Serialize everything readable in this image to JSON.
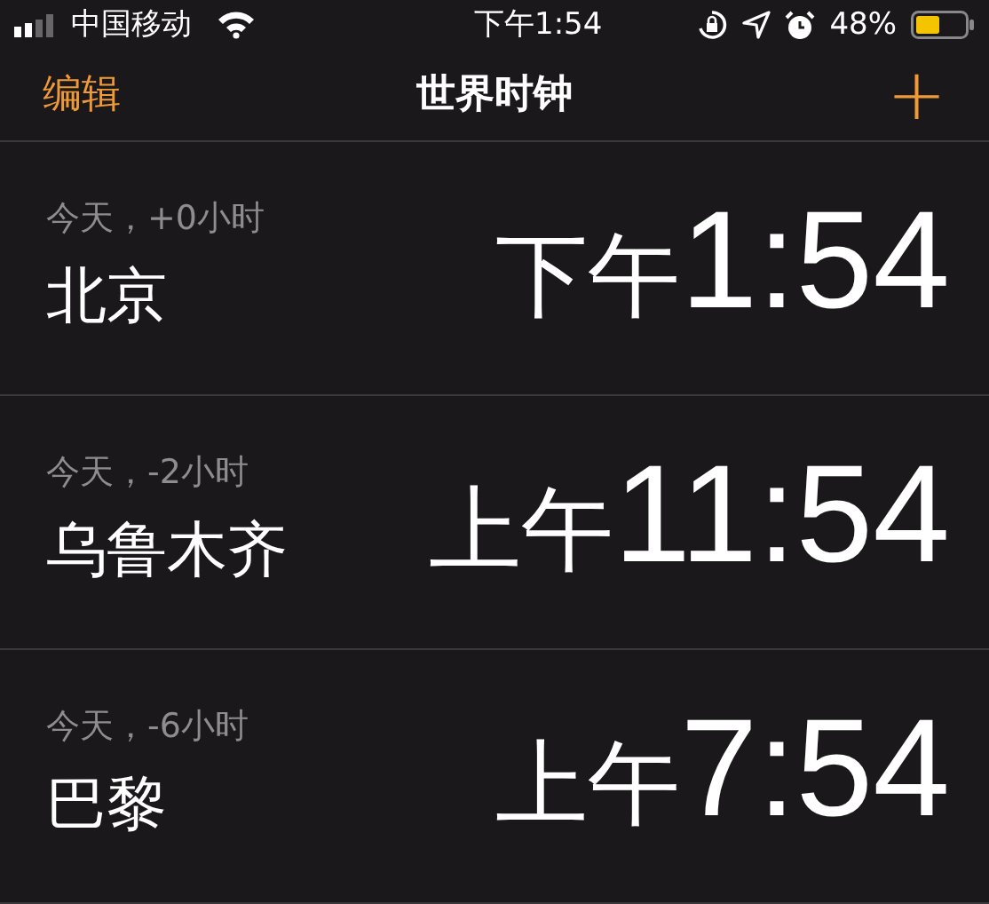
{
  "status_bar": {
    "carrier": "中国移动",
    "time": "下午1:54",
    "battery": "48%"
  },
  "nav": {
    "edit": "编辑",
    "title": "世界时钟",
    "add": "+"
  },
  "clocks": [
    {
      "offset": "今天，+0小时",
      "city": "北京",
      "meridiem": "下午",
      "time": "1:54"
    },
    {
      "offset": "今天，-2小时",
      "city": "乌鲁木齐",
      "meridiem": "上午",
      "time": "11:54"
    },
    {
      "offset": "今天，-6小时",
      "city": "巴黎",
      "meridiem": "上午",
      "time": "7:54"
    }
  ]
}
